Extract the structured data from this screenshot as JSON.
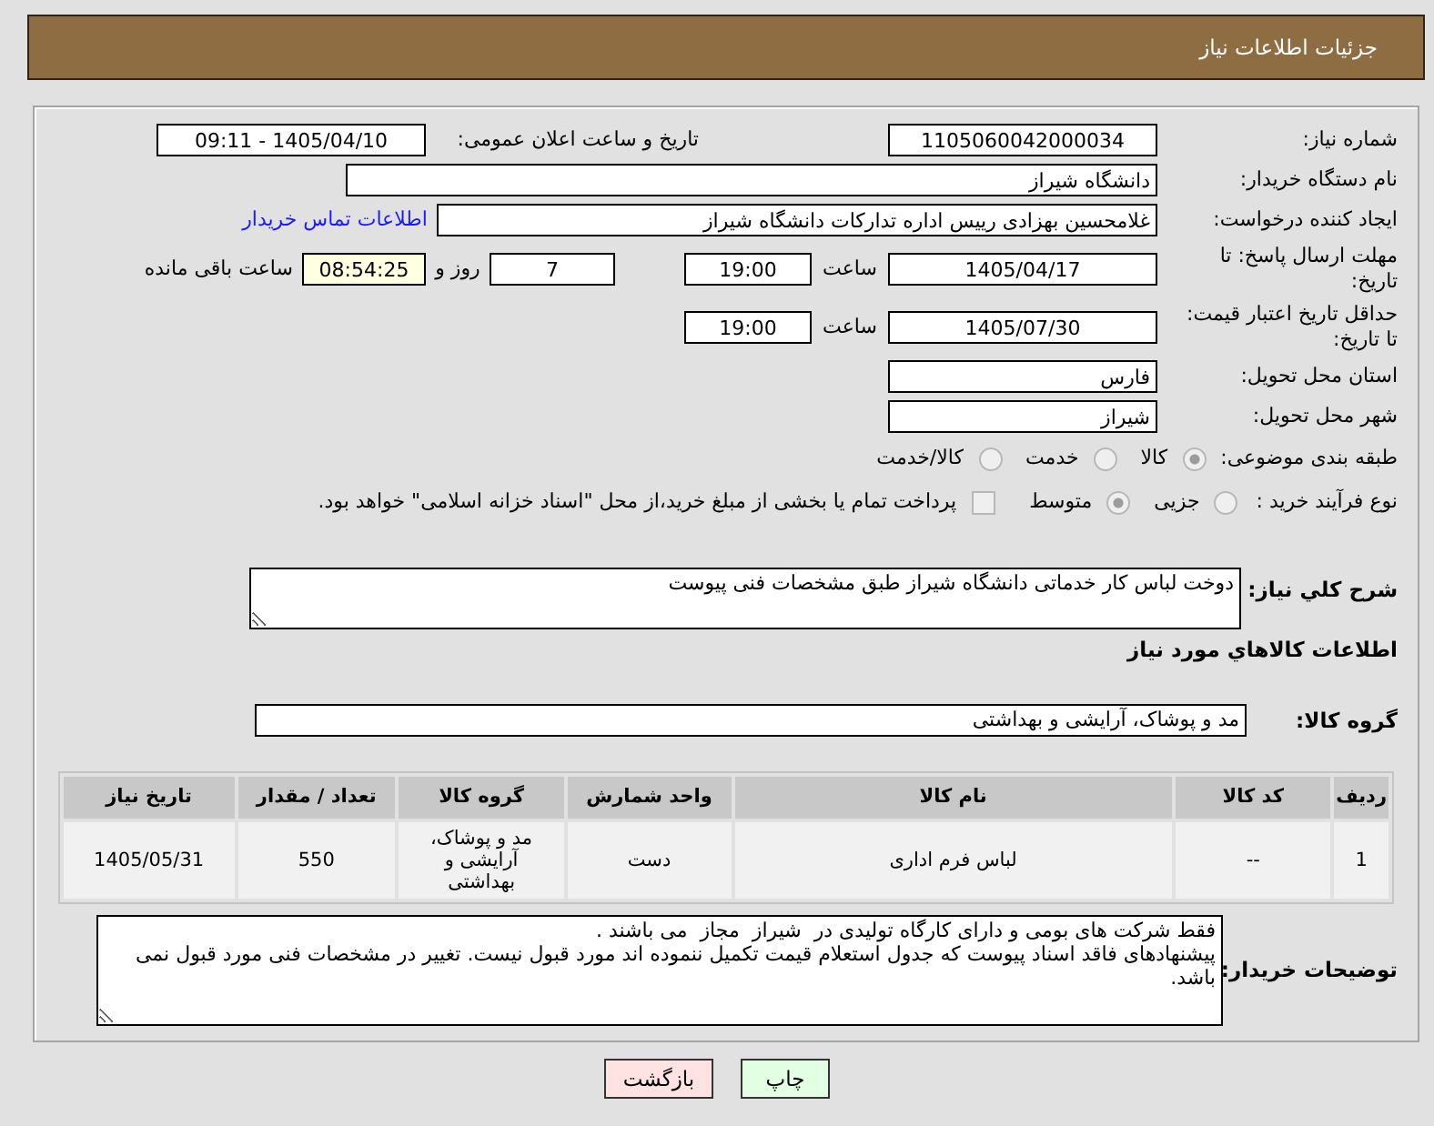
{
  "header": {
    "title": "جزئیات اطلاعات نیاز"
  },
  "need_number": {
    "label": "شماره نیاز:",
    "value": "1105060042000034"
  },
  "announce_datetime": {
    "label": "تاریخ و ساعت اعلان عمومی:",
    "value": "1405/04/10 - 09:11"
  },
  "buyer_org": {
    "label": "نام دستگاه خریدار:",
    "value": "دانشگاه شیراز"
  },
  "requester": {
    "label": "ایجاد کننده درخواست:",
    "value": "غلامحسین بهزادی رییس اداره تدارکات دانشگاه شیراز",
    "link": "اطلاعات تماس خریدار"
  },
  "response_deadline": {
    "label": "مهلت ارسال پاسخ: تا تاریخ:",
    "date": "1405/04/17",
    "time_label": "ساعت",
    "time": "19:00",
    "days": "7",
    "days_label": "روز و",
    "remaining": "08:54:25",
    "remaining_label": "ساعت باقی مانده"
  },
  "price_validity": {
    "label": "حداقل تاریخ اعتبار قیمت: تا تاریخ:",
    "date": "1405/07/30",
    "time_label": "ساعت",
    "time": "19:00"
  },
  "delivery_province": {
    "label": "استان محل تحویل:",
    "value": "فارس"
  },
  "delivery_city": {
    "label": "شهر محل تحویل:",
    "value": "شیراز"
  },
  "category": {
    "label": "طبقه بندی موضوعی:",
    "options": [
      {
        "label": "کالا",
        "selected": true,
        "disabled": true
      },
      {
        "label": "خدمت",
        "selected": false,
        "disabled": true
      },
      {
        "label": "کالا/خدمت",
        "selected": false,
        "disabled": true
      }
    ]
  },
  "purchase_process": {
    "label": "نوع فرآیند خرید :",
    "options": [
      {
        "label": "جزیی",
        "selected": false,
        "disabled": true
      },
      {
        "label": "متوسط",
        "selected": true,
        "disabled": true
      }
    ],
    "treasury": {
      "label": "پرداخت تمام یا بخشی از مبلغ خرید،از محل \"اسناد خزانه اسلامی\" خواهد بود.",
      "checked": false,
      "disabled": true
    }
  },
  "description": {
    "label": "شرح كلي نياز:",
    "value": "دوخت لباس کار خدماتی دانشگاه شیراز طبق مشخصات فنی پیوست"
  },
  "items_title": "اطلاعات كالاهاي مورد نياز",
  "goods_group": {
    "label": "گروه کالا:",
    "value": "مد و پوشاک، آرایشی و بهداشتی"
  },
  "table": {
    "columns": [
      "ردیف",
      "کد کالا",
      "نام کالا",
      "واحد شمارش",
      "گروه کالا",
      "تعداد / مقدار",
      "تاریخ نیاز"
    ],
    "rows": [
      [
        "1",
        "--",
        "لباس فرم اداری",
        "دست",
        "مد و پوشاک، آرایشی و بهداشتی",
        "550",
        "1405/05/31"
      ]
    ]
  },
  "buyer_notes": {
    "label": "توضیحات خریدار:",
    "lines": [
      "فقط شرکت های بومی و دارای کارگاه تولیدی در  شیراز  مجاز  می باشند .",
      "پیشنهادهای فاقد اسناد پیوست که جدول استعلام قیمت تکمیل ننموده اند مورد قبول نیست. تغییر در مشخصات فنی مورد قبول نمی باشد."
    ]
  },
  "buttons": [
    {
      "label": "چاپ",
      "kind": "print"
    },
    {
      "label": "بازگشت",
      "kind": "back"
    }
  ]
}
